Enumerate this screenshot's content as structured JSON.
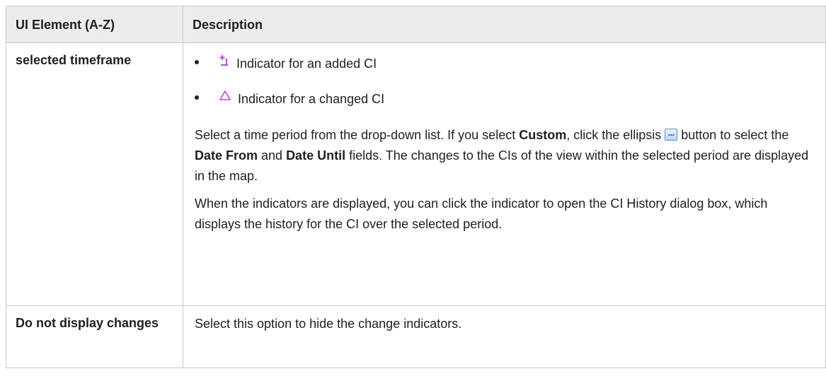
{
  "table": {
    "headers": [
      "UI Element (A-Z)",
      "Description"
    ],
    "rows": [
      {
        "term": "selected timeframe",
        "indicators": [
          {
            "icon": "added-ci-icon",
            "label": "Indicator for an added CI"
          },
          {
            "icon": "changed-ci-icon",
            "label": "Indicator for a changed CI"
          }
        ],
        "para1": {
          "t1": "Select a time period from the drop-down list. If you select ",
          "b1": "Custom",
          "t2": ", click the ellipsis ",
          "icon": "ellipsis-button-icon",
          "t3": " button to select the ",
          "b2": "Date From",
          "t4": " and ",
          "b3": "Date Until",
          "t5": " fields. The changes to the CIs of the view within the selected period are displayed in the map."
        },
        "para2": "When the indicators are displayed, you can click the indicator to open the CI History dialog box, which displays the history for the CI over the selected period."
      },
      {
        "term": "Do not display changes",
        "description": "Select this option to hide the change indicators."
      }
    ]
  },
  "colors": {
    "header_bg": "#ececec",
    "border": "#c8c8c8",
    "added_icon": "#b44ad6",
    "changed_icon": "#b44ad6"
  }
}
